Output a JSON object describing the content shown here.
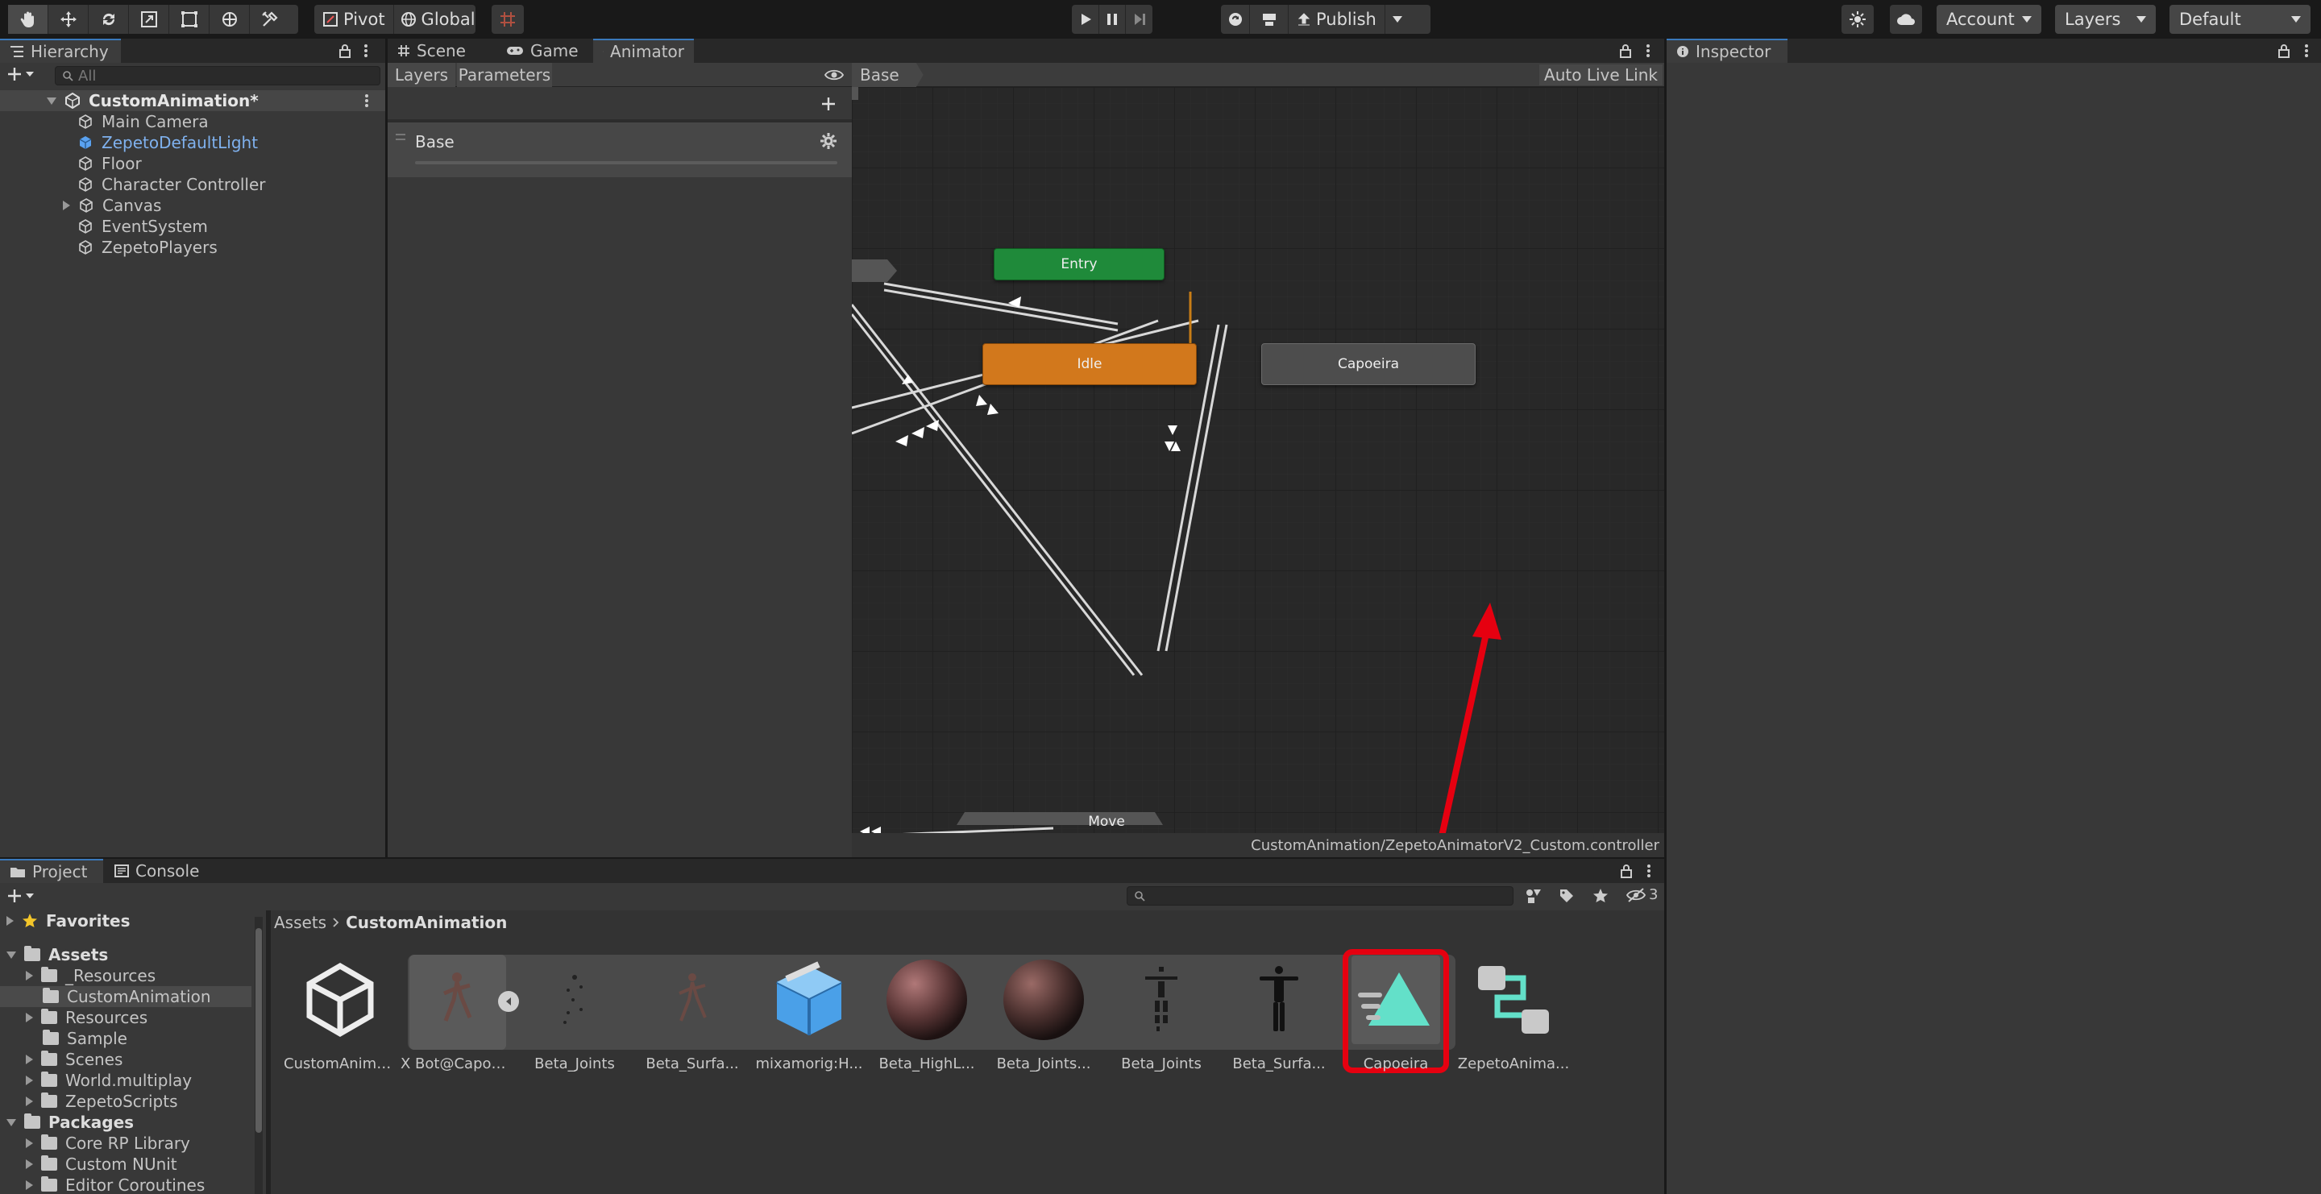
{
  "toolbar": {
    "pivot": "Pivot",
    "global": "Global",
    "publish": "Publish",
    "account": "Account",
    "layers": "Layers",
    "layout": "Default"
  },
  "hierarchy": {
    "tab": "Hierarchy",
    "search_placeholder": "All",
    "scene": "CustomAnimation*",
    "items": [
      "Main Camera",
      "ZepetoDefaultLight",
      "Floor",
      "Character Controller",
      "Canvas",
      "EventSystem",
      "ZepetoPlayers"
    ]
  },
  "center_tabs": {
    "scene": "Scene",
    "game": "Game",
    "animator": "Animator"
  },
  "animator": {
    "layers_tab": "Layers",
    "parameters_tab": "Parameters",
    "layer_name": "Base",
    "breadcrumb": "Base",
    "auto_live_link": "Auto Live Link",
    "nodes": {
      "entry": "Entry",
      "idle": "Idle",
      "capoeira": "Capoeira",
      "move": "Move"
    },
    "footer_path": "CustomAnimation/ZepetoAnimatorV2_Custom.controller"
  },
  "inspector": {
    "tab": "Inspector"
  },
  "project": {
    "tab": "Project",
    "console_tab": "Console",
    "hidden_count": "3",
    "breadcrumb_root": "Assets",
    "breadcrumb_current": "CustomAnimation",
    "tree": {
      "favorites": "Favorites",
      "assets": "Assets",
      "asset_folders": [
        "_Resources",
        "CustomAnimation",
        "Resources",
        "Sample",
        "Scenes",
        "World.multiplay",
        "ZepetoScripts"
      ],
      "packages": "Packages",
      "package_folders": [
        "Core RP Library",
        "Custom NUnit",
        "Editor Coroutines"
      ]
    },
    "assets": [
      "CustomAnimat...",
      "X Bot@Capoei...",
      "Beta_Joints",
      "Beta_Surfa...",
      "mixamorig:H...",
      "Beta_HighL...",
      "Beta_Joints...",
      "Beta_Joints",
      "Beta_Surfa...",
      "Capoeira",
      "ZepetoAnima..."
    ]
  },
  "colors": {
    "entry_node": "#1f8a3a",
    "idle_node": "#d2781c",
    "highlight": "#e60010",
    "accent": "#3a79bb"
  }
}
